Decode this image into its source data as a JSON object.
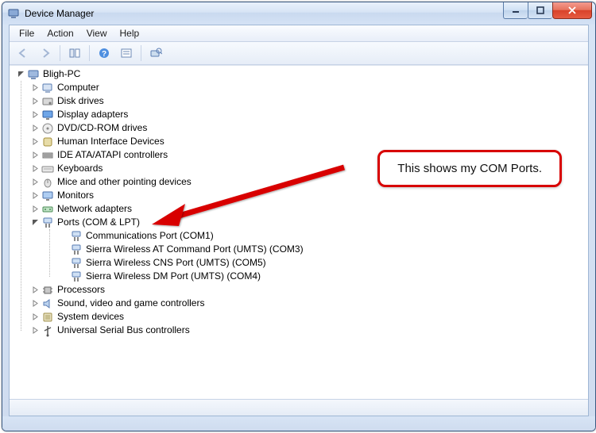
{
  "window": {
    "title": "Device Manager"
  },
  "menu": {
    "file": "File",
    "action": "Action",
    "view": "View",
    "help": "Help"
  },
  "tree": {
    "root": "Bligh-PC",
    "nodes": {
      "computer": "Computer",
      "disk": "Disk drives",
      "display": "Display adapters",
      "dvd": "DVD/CD-ROM drives",
      "hid": "Human Interface Devices",
      "ide": "IDE ATA/ATAPI controllers",
      "keyboards": "Keyboards",
      "mice": "Mice and other pointing devices",
      "monitors": "Monitors",
      "network": "Network adapters",
      "ports": "Ports (COM & LPT)",
      "processors": "Processors",
      "sound": "Sound, video and game controllers",
      "system": "System devices",
      "usb": "Universal Serial Bus controllers"
    },
    "ports_children": {
      "c0": "Communications Port (COM1)",
      "c1": "Sierra Wireless AT Command Port (UMTS) (COM3)",
      "c2": "Sierra Wireless CNS Port (UMTS) (COM5)",
      "c3": "Sierra Wireless DM Port (UMTS) (COM4)"
    }
  },
  "annotation": {
    "text": "This shows my  COM Ports."
  }
}
